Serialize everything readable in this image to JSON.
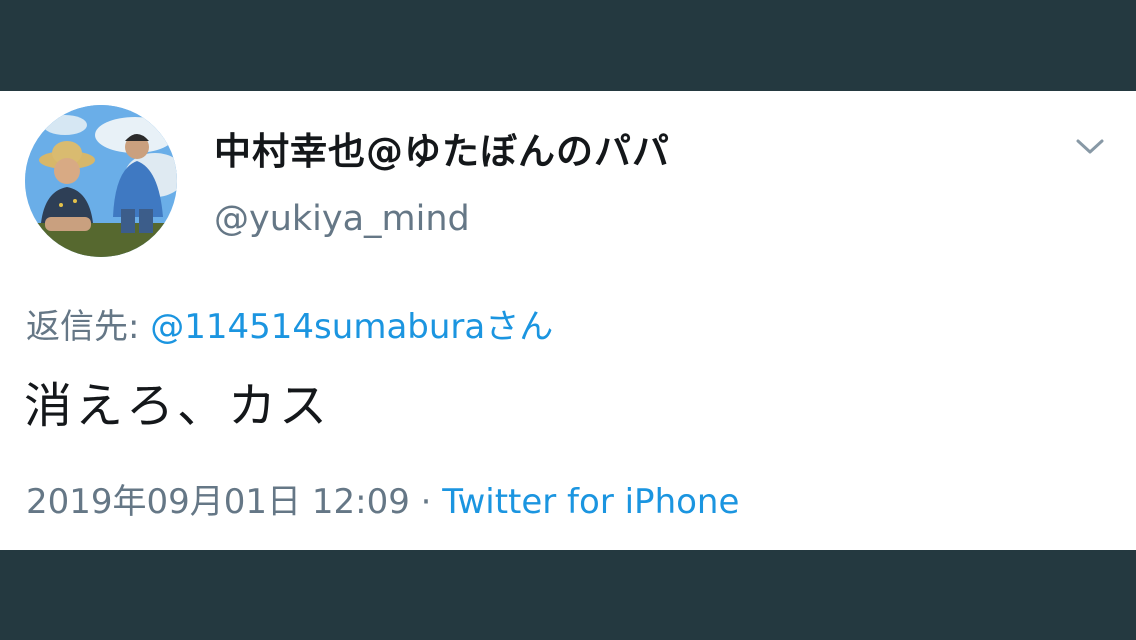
{
  "tweet": {
    "display_name": "中村幸也@ゆたぼんのパパ",
    "handle": "@yukiya_mind",
    "reply_prefix": "返信先: ",
    "reply_to": "@114514sumaburaさん",
    "text": "消えろ、カス",
    "timestamp": "2019年09月01日 12:09",
    "separator": " · ",
    "source": "Twitter for iPhone",
    "menu_icon": "chevron-down-icon",
    "avatar_icon": "profile-photo"
  },
  "colors": {
    "background": "#243940",
    "card": "#ffffff",
    "link": "#1b95e0",
    "muted": "#657786",
    "text": "#14171a"
  }
}
